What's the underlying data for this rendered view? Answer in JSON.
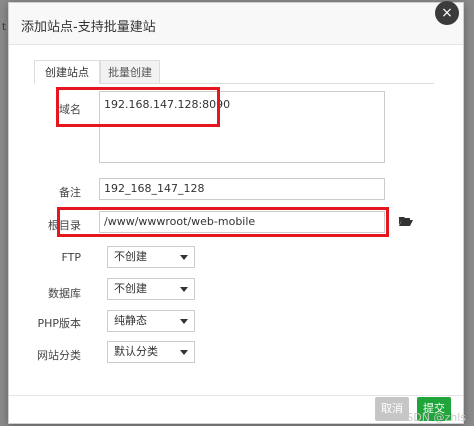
{
  "background": {
    "edge_text": "t"
  },
  "dialog": {
    "title": "添加站点-支持批量建站",
    "close_symbol": "×"
  },
  "tabs": [
    {
      "label": "创建站点",
      "active": true
    },
    {
      "label": "批量创建",
      "active": false
    }
  ],
  "form": {
    "domain": {
      "label": "域名",
      "value": "192.168.147.128:8090"
    },
    "remark": {
      "label": "备注",
      "value": "192_168_147_128"
    },
    "root": {
      "label": "根目录",
      "value": "/www/wwwroot/web-mobile"
    },
    "ftp": {
      "label": "FTP",
      "value": "不创建"
    },
    "database": {
      "label": "数据库",
      "value": "不创建"
    },
    "php": {
      "label": "PHP版本",
      "value": "纯静态"
    },
    "category": {
      "label": "网站分类",
      "value": "默认分类"
    }
  },
  "buttons": {
    "cancel": "取消",
    "submit": "提交"
  },
  "colors": {
    "highlight": "#e5161d",
    "submit": "#20a53a",
    "cancel": "#c6c6c6"
  },
  "watermark": "CSDN @zhls"
}
